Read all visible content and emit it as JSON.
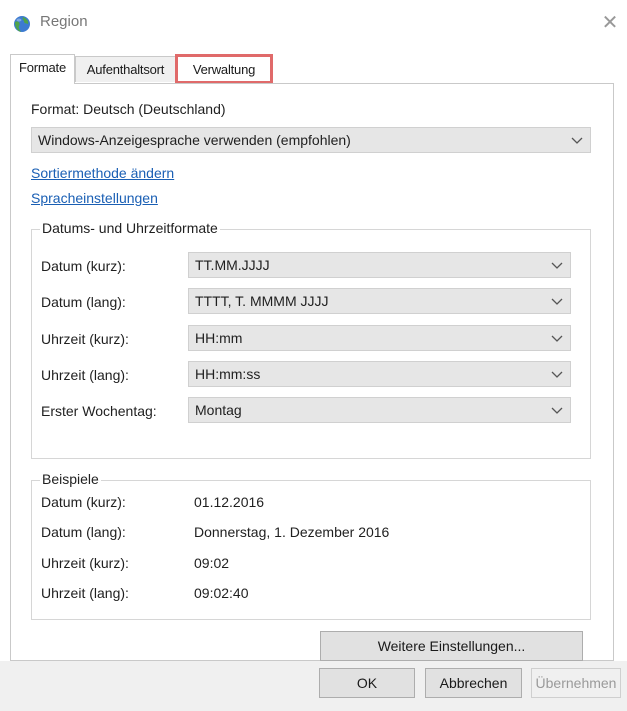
{
  "window": {
    "title": "Region",
    "close_symbol": "✕",
    "app_icon": "globe-icon"
  },
  "tabs": [
    {
      "label": "Formate",
      "active": true
    },
    {
      "label": "Aufenthaltsort",
      "active": false
    },
    {
      "label": "Verwaltung",
      "active": false,
      "highlighted": true
    }
  ],
  "formats": {
    "format_label": "Format: Deutsch (Deutschland)",
    "language_select": "Windows-Anzeigesprache verwenden (empfohlen)",
    "sort_link": "Sortiermethode ändern",
    "language_link": "Spracheinstellungen"
  },
  "datetime": {
    "legend": "Datums- und Uhrzeitformate",
    "rows": [
      {
        "label": "Datum (kurz):",
        "value": "TT.MM.JJJJ"
      },
      {
        "label": "Datum (lang):",
        "value": "TTTT, T. MMMM JJJJ"
      },
      {
        "label": "Uhrzeit (kurz):",
        "value": "HH:mm"
      },
      {
        "label": "Uhrzeit (lang):",
        "value": "HH:mm:ss"
      },
      {
        "label": "Erster Wochentag:",
        "value": "Montag"
      }
    ]
  },
  "examples": {
    "legend": "Beispiele",
    "rows": [
      {
        "label": "Datum (kurz):",
        "value": "01.12.2016"
      },
      {
        "label": "Datum (lang):",
        "value": "Donnerstag, 1. Dezember 2016"
      },
      {
        "label": "Uhrzeit (kurz):",
        "value": "09:02"
      },
      {
        "label": "Uhrzeit (lang):",
        "value": "09:02:40"
      }
    ]
  },
  "buttons": {
    "more_settings": "Weitere Einstellungen...",
    "ok": "OK",
    "cancel": "Abbrechen",
    "apply": "Übernehmen"
  },
  "colors": {
    "link": "#1a5fb4",
    "highlight": "#e06a6a",
    "select_bg": "#e6e6e6"
  }
}
